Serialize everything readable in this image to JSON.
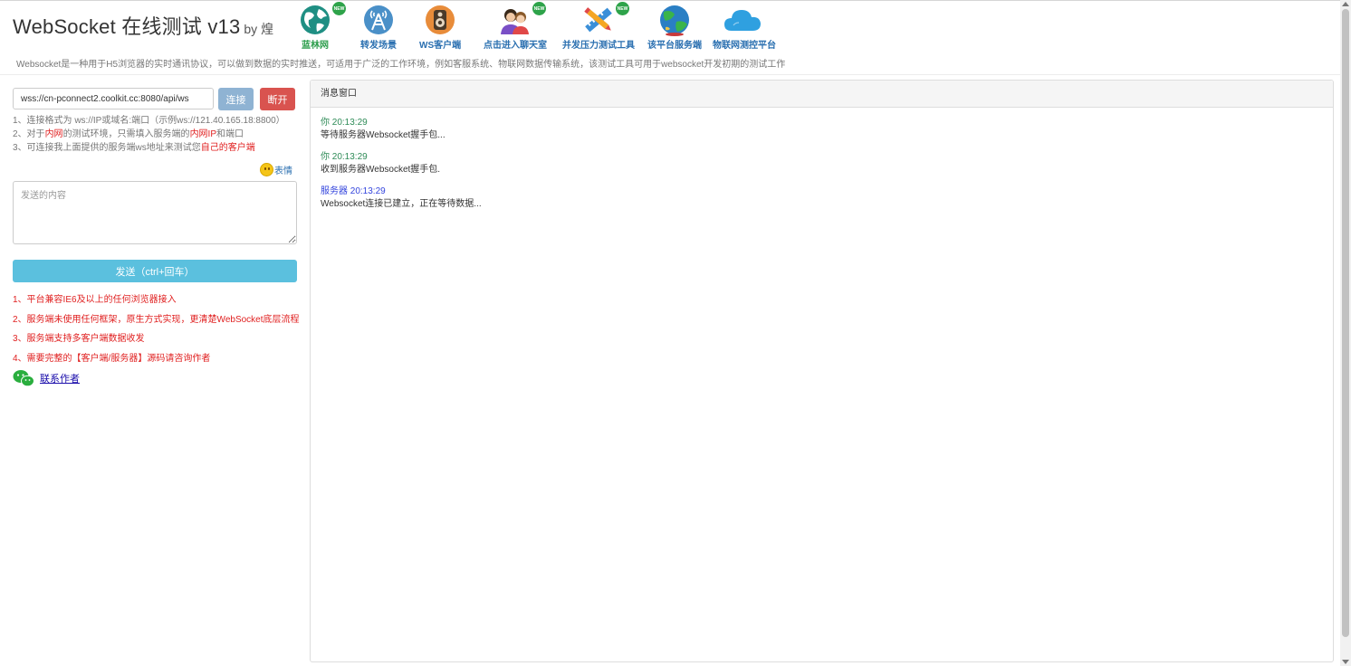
{
  "header": {
    "title": "WebSocket 在线测试 v13",
    "by": "by 煌",
    "description": "Websocket是一种用于H5浏览器的实时通讯协议，可以做到数据的实时推送，可适用于广泛的工作环境，例如客服系统、物联网数据传输系统，该测试工具可用于websocket开发初期的测试工作"
  },
  "nav": [
    {
      "label": "蓝林网",
      "icon": "globe-icon",
      "new": "NEW"
    },
    {
      "label": "转发场景",
      "icon": "antenna-icon"
    },
    {
      "label": "WS客户端",
      "icon": "speaker-icon"
    },
    {
      "label": "点击进入聊天室",
      "icon": "people-icon",
      "new": "NEW"
    },
    {
      "label": "并发压力测试工具",
      "icon": "pencil-ruler-icon",
      "new": "NEW"
    },
    {
      "label": "该平台服务端",
      "icon": "planet-icon"
    },
    {
      "label": "物联网测控平台",
      "icon": "cloud-icon"
    }
  ],
  "connection": {
    "url_value": "wss://cn-pconnect2.coolkit.cc:8080/api/ws",
    "connect_label": "连接",
    "disconnect_label": "断开"
  },
  "tips": {
    "line1": "1、连接格式为 ws://IP或域名:端口（示例ws://121.40.165.18:8800）",
    "line2_a": "2、对于",
    "line2_b": "内网",
    "line2_c": "的测试环境，只需填入服务端的",
    "line2_d": "内网IP",
    "line2_e": "和端口",
    "line3_a": "3、可连接我上面提供的服务端ws地址来测试您",
    "line3_b": "自己的客户端"
  },
  "emoji_label": "表情",
  "composer": {
    "placeholder": "发送的内容",
    "send_label": "发送（ctrl+回车）"
  },
  "notes": [
    "1、平台兼容IE6及以上的任何浏览器接入",
    "2、服务端未使用任何框架，原生方式实现，更清楚WebSocket底层流程",
    "3、服务端支持多客户端数据收发",
    "4、需要完整的【客户端/服务器】源码请咨询作者"
  ],
  "contact_label": "联系作者",
  "panel": {
    "title": "消息窗口",
    "messages": [
      {
        "who": "你 20:13:29",
        "text": "等待服务器Websocket握手包..."
      },
      {
        "who": "你 20:13:29",
        "text": "收到服务器Websocket握手包."
      },
      {
        "who": "服务器 20:13:29",
        "text": "Websocket连接已建立，正在等待数据..."
      }
    ]
  },
  "colors": {
    "connect": "#8fb3d3",
    "disconnect": "#d9534f",
    "send": "#5bc0de",
    "note_red": "#e02020",
    "me": "#2e8b57",
    "server": "#3344dd"
  }
}
